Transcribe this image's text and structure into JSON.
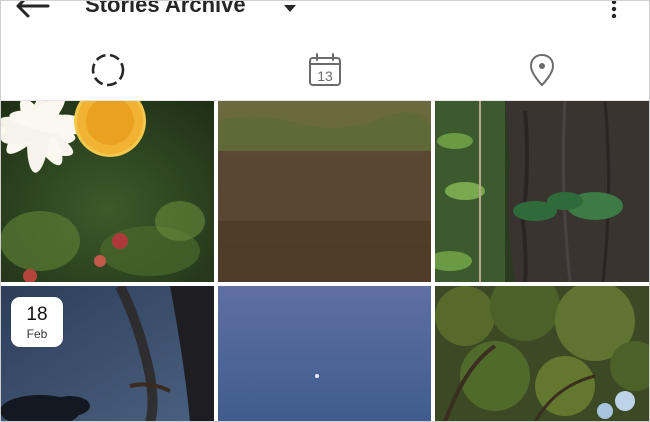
{
  "header": {
    "title": "Stories Archive"
  },
  "tabs": [
    {
      "label": "stories",
      "icon": "circle-dashed-icon",
      "active": true
    },
    {
      "label": "calendar",
      "icon": "calendar-icon",
      "date_number": "13"
    },
    {
      "label": "locations",
      "icon": "location-pin-icon"
    }
  ],
  "grid": {
    "items": [
      {
        "subject": "daisy-photo"
      },
      {
        "subject": "field-photo"
      },
      {
        "subject": "tree-trunk-photo"
      },
      {
        "subject": "dusk-sky-photo",
        "date_badge": {
          "day": "18",
          "month": "Feb"
        }
      },
      {
        "subject": "blue-sky-moon-photo"
      },
      {
        "subject": "tree-canopy-photo"
      }
    ]
  },
  "colors": {
    "icon": "#6b6b6b",
    "text": "#262626",
    "divider": "#e6e6e6"
  }
}
